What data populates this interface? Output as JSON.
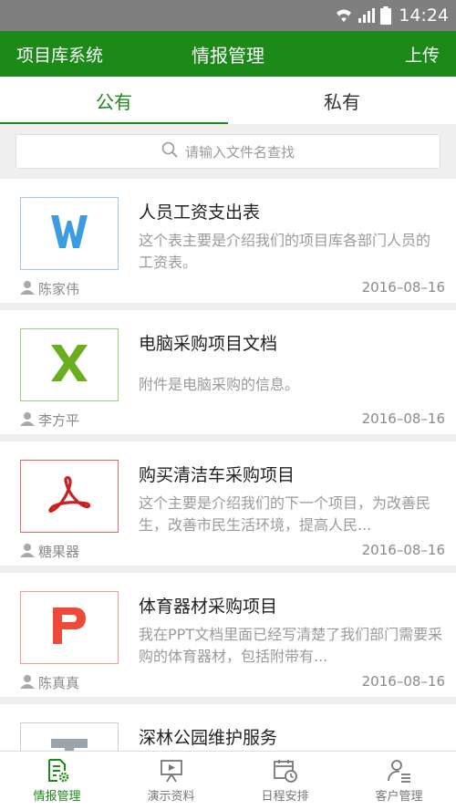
{
  "status_bar": {
    "time": "14:24"
  },
  "app_bar": {
    "left": "项目库系统",
    "title": "情报管理",
    "right": "上传"
  },
  "tabs": [
    {
      "label": "公有",
      "active": true
    },
    {
      "label": "私有",
      "active": false
    }
  ],
  "search": {
    "placeholder": "请输入文件名查找"
  },
  "items": [
    {
      "icon": "word-icon",
      "color": "#3d9be0",
      "border": "#9fc9ea",
      "title": "人员工资支出表",
      "desc": "这个表主要是介绍我们的项目库各部门人员的工资表。",
      "author": "陈家伟",
      "date": "2016–08–16"
    },
    {
      "icon": "excel-icon",
      "color": "#6aae1e",
      "border": "#9dd07a",
      "title": "电脑采购项目文档",
      "desc": "附件是电脑采购的信息。",
      "author": "李方平",
      "date": "2016–08–16"
    },
    {
      "icon": "pdf-icon",
      "color": "#cc2020",
      "border": "#d96b6b",
      "title": "购买清洁车采购项目",
      "desc": "这个主要是介绍我们的下一个项目，为改善民生，改善市民生活环境，提高人民...",
      "author": "糖果器",
      "date": "2016–08–16"
    },
    {
      "icon": "ppt-icon",
      "color": "#ee4a3a",
      "border": "#f09c93",
      "title": "体育器材采购项目",
      "desc": "我在PPT文档里面已经写清楚了我们部门需要采购的体育器材，包括附带有...",
      "author": "陈真真",
      "date": "2016–08–16"
    },
    {
      "icon": "text-icon",
      "color": "#9aa4ad",
      "border": "#c9ced2",
      "title": "深林公园维护服务",
      "desc": "",
      "author": "",
      "date": ""
    }
  ],
  "bottom_nav": [
    {
      "label": "情报管理",
      "icon": "document-gear-icon",
      "active": true
    },
    {
      "label": "演示资料",
      "icon": "presentation-icon",
      "active": false
    },
    {
      "label": "日程安排",
      "icon": "calendar-clock-icon",
      "active": false
    },
    {
      "label": "客户管理",
      "icon": "user-list-icon",
      "active": false
    }
  ],
  "colors": {
    "primary": "#1b8a18",
    "status_bar": "#7f7f7f",
    "background": "#efefef"
  }
}
